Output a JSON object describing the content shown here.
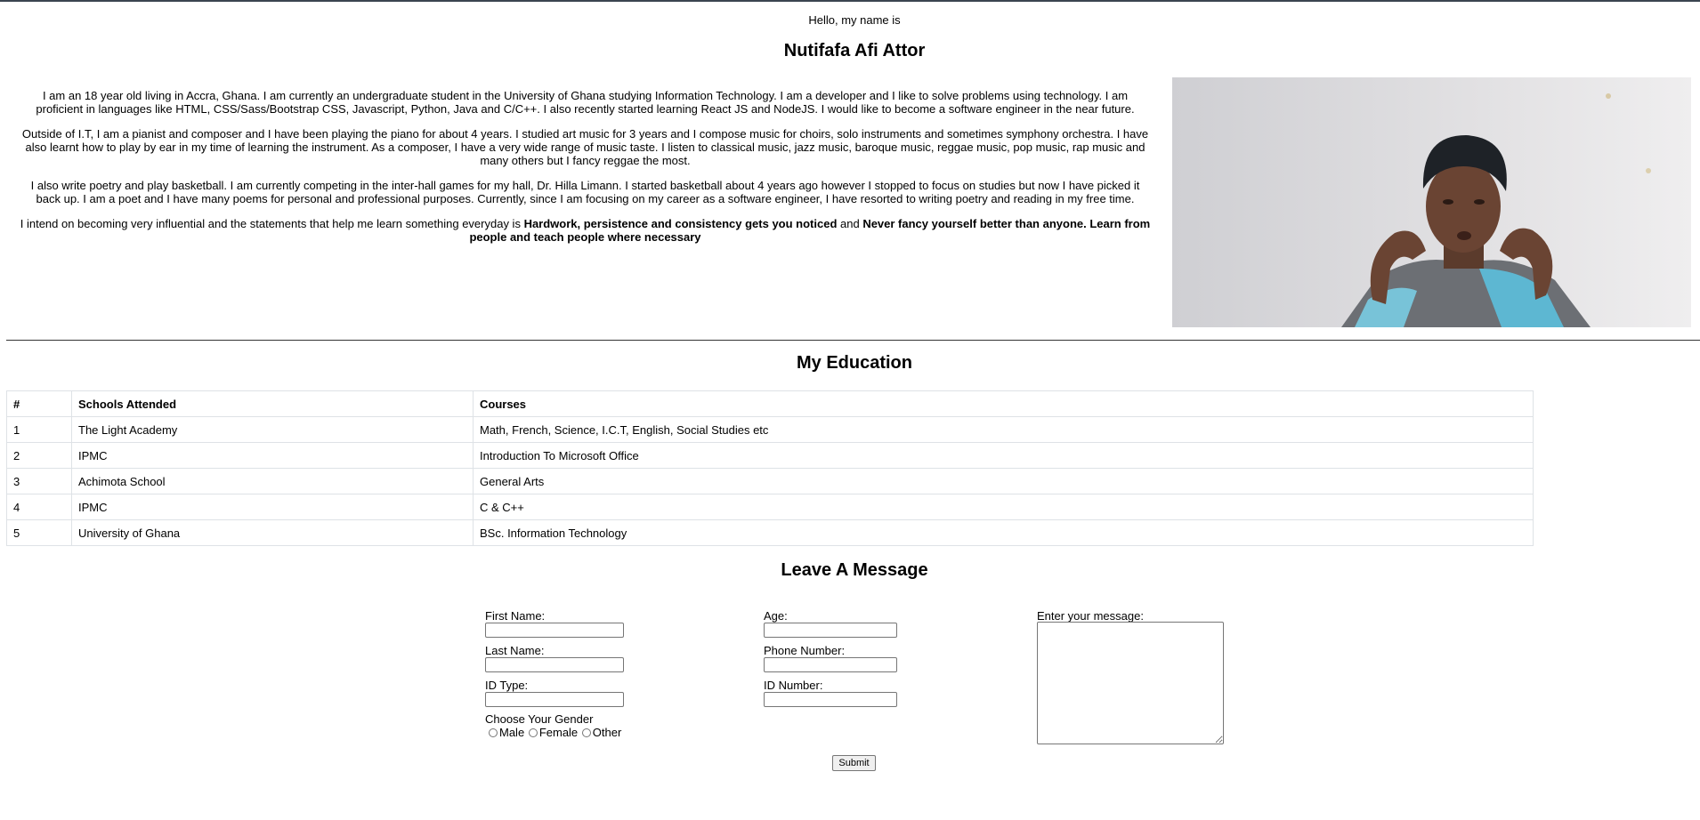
{
  "hero": {
    "greeting": "Hello, my name is",
    "name": "Nutifafa Afi Attor",
    "bio": [
      "I am an 18 year old living in Accra, Ghana. I am currently an undergraduate student in the University of Ghana studying Information Technology. I am a developer and I like to solve problems using technology. I am proficient in languages like HTML, CSS/Sass/Bootstrap CSS, Javascript, Python, Java and C/C++. I also recently started learning React JS and NodeJS. I would like to become a software engineer in the near future.",
      "Outside of I.T, I am a pianist and composer and I have been playing the piano for about 4 years. I studied art music for 3 years and I compose music for choirs, solo instruments and sometimes symphony orchestra. I have also learnt how to play by ear in my time of learning the instrument. As a composer, I have a very wide range of music taste. I listen to classical music, jazz music, baroque music, reggae music, pop music, rap music and many others but I fancy reggae the most.",
      "I also write poetry and play basketball. I am currently competing in the inter-hall games for my hall, Dr. Hilla Limann. I started basketball about 4 years ago however I stopped to focus on studies but now I have picked it back up. I am a poet and I have many poems for personal and professional purposes. Currently, since I am focusing on my career as a software engineer, I have resorted to writing poetry and reading in my free time."
    ],
    "motto_intro": "I intend on becoming very influential and the statements that help me learn something everyday is ",
    "motto_one": "Hardwork, persistence and consistency gets you noticed",
    "motto_joiner": " and ",
    "motto_two": "Never fancy yourself better than anyone. Learn from people and teach people where necessary"
  },
  "education": {
    "title": "My Education",
    "headers": [
      "#",
      "Schools Attended",
      "Courses"
    ],
    "rows": [
      [
        "1",
        "The Light Academy",
        "Math, French, Science, I.C.T, English, Social Studies etc"
      ],
      [
        "2",
        "IPMC",
        "Introduction To Microsoft Office"
      ],
      [
        "3",
        "Achimota School",
        "General Arts"
      ],
      [
        "4",
        "IPMC",
        "C & C++"
      ],
      [
        "5",
        "University of Ghana",
        "BSc. Information Technology"
      ]
    ]
  },
  "form": {
    "title": "Leave A Message",
    "first_name_label": "First Name:",
    "last_name_label": "Last Name:",
    "id_type_label": "ID Type:",
    "age_label": "Age:",
    "phone_label": "Phone Number:",
    "id_number_label": "ID Number:",
    "message_label": "Enter your message:",
    "gender_label": "Choose Your Gender",
    "gender_options": [
      "Male",
      "Female",
      "Other"
    ],
    "submit_label": "Submit"
  }
}
